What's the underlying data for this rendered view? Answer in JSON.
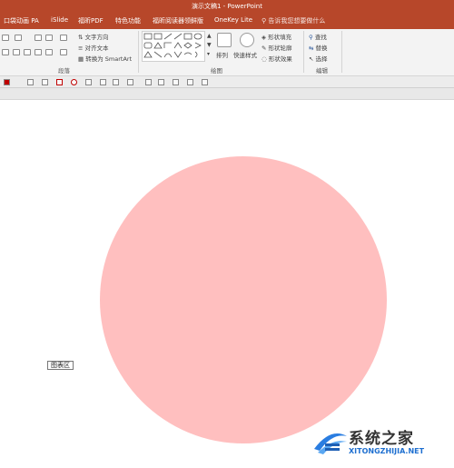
{
  "window": {
    "title": "演示文稿1 - PowerPoint"
  },
  "tabs": [
    {
      "label": "口袋动画 PA"
    },
    {
      "label": "iSlide"
    },
    {
      "label": "福昕PDF"
    },
    {
      "label": "特色功能"
    },
    {
      "label": "福昕阅读器领鲜版"
    },
    {
      "label": "OneKey Lite"
    }
  ],
  "tell_me": {
    "label": "告诉我您想要做什么"
  },
  "ribbon": {
    "paragraph": {
      "text_direction": "文字方向",
      "align_text": "对齐文本",
      "convert_smartart": "转换为 SmartArt",
      "group_label": "段落"
    },
    "drawing": {
      "arrange": "排列",
      "quick_styles": "快速样式",
      "shape_fill": "形状填充",
      "shape_outline": "形状轮廓",
      "shape_effects": "形状效果",
      "group_label": "绘图"
    },
    "editing": {
      "find": "查找",
      "replace": "替换",
      "select": "选择",
      "group_label": "编辑"
    }
  },
  "slide": {
    "chart_tooltip": "图表区",
    "pie_color": "#ffbfbf"
  },
  "watermark": {
    "title": "系统之家",
    "url": "XITONGZHIJIA.NET"
  }
}
